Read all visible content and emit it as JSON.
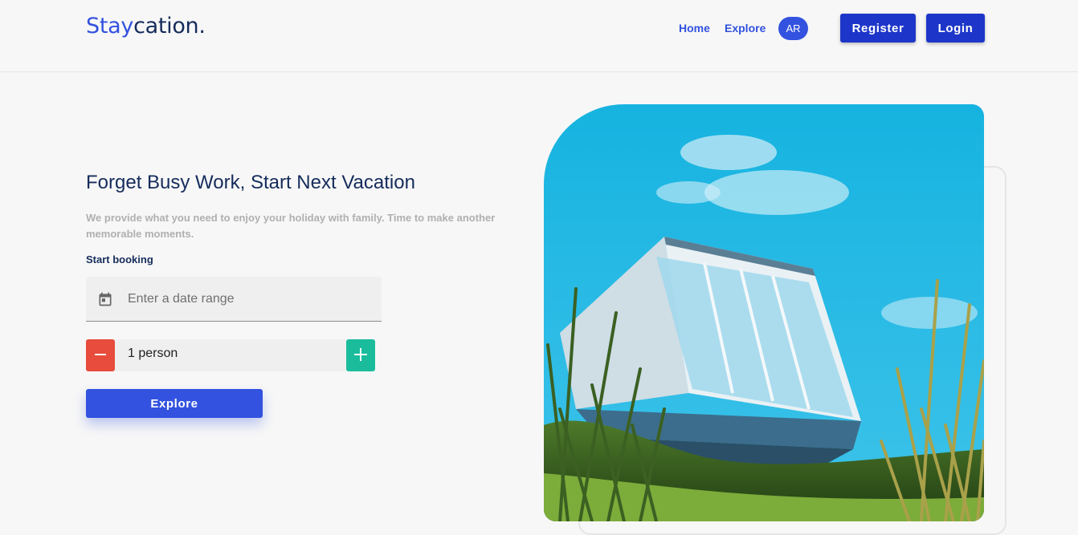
{
  "header": {
    "brand_part1": "Stay",
    "brand_part2": "cation.",
    "nav": {
      "home": "Home",
      "explore": "Explore"
    },
    "avatar_initials": "AR",
    "register_label": "Register",
    "login_label": "Login"
  },
  "hero": {
    "title": "Forget Busy Work, Start Next Vacation",
    "subtitle": "We provide what you need to enjoy your holiday with family. Time to make another memorable moments.",
    "start_label": "Start booking",
    "date_placeholder": "Enter a date range",
    "person_value": "1 person",
    "explore_label": "Explore"
  },
  "icons": {
    "calendar": "calendar-icon",
    "minus": "minus-icon",
    "plus": "plus-icon"
  },
  "colors": {
    "brand_blue": "#3252df",
    "navy": "#152c5b",
    "minus_red": "#e74c3c",
    "plus_green": "#1abc9c"
  }
}
